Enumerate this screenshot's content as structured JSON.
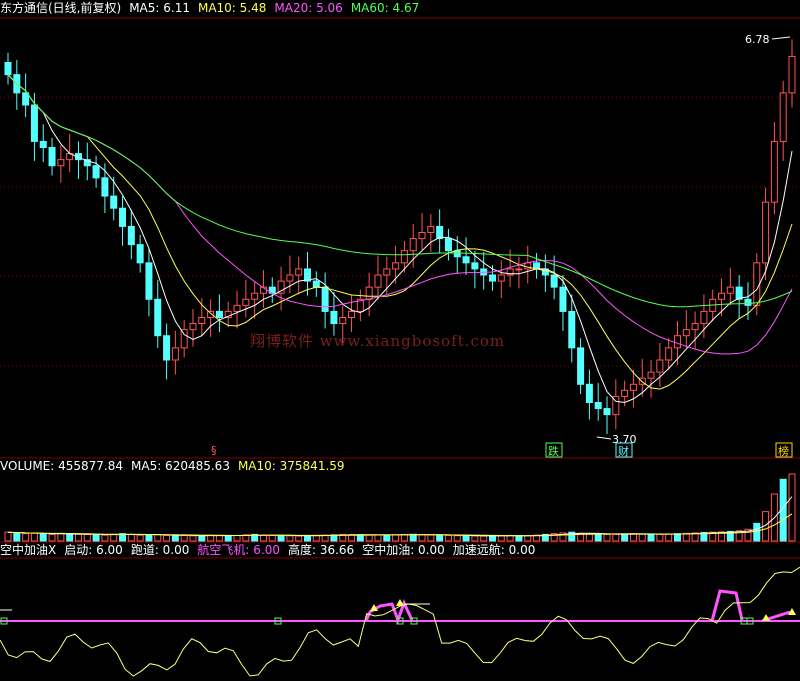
{
  "header_main": {
    "title": "东方通信(日线,前复权)",
    "ma5": "MA5: 6.11",
    "ma10": "MA10: 5.48",
    "ma20": "MA20: 5.06",
    "ma60": "MA60: 4.67"
  },
  "header_volume": {
    "volume": "VOLUME: 455877.84",
    "ma5": "MA5: 620485.63",
    "ma10": "MA10: 375841.59"
  },
  "header_indicator": {
    "name": "空中加油X",
    "qidong": "启动: 6.00",
    "paodao": "跑道: 0.00",
    "hangkong": "航空飞机: 6.00",
    "gaodu": "高度: 36.66",
    "kongzhong": "空中加油: 0.00",
    "jiasu": "加速远航: 0.00"
  },
  "annotations": {
    "high_label": "6.78",
    "low_label": "3.70",
    "marker_s": "§",
    "marker_die": "跌",
    "marker_cai": "财",
    "marker_bang": "榜"
  },
  "watermark": "翔博软件 www.xiangbosoft.com",
  "colors": {
    "up": "#ff5454",
    "down": "#54ffff",
    "ma5": "#ffffff",
    "ma10": "#ffff54",
    "ma20": "#ff54ff",
    "ma60": "#54ff54",
    "grid": "#800000"
  },
  "chart_data": [
    {
      "type": "candlestick",
      "title": "东方通信(日线,前复权)",
      "ylim": [
        3.5,
        7.0
      ],
      "low_value": 3.7,
      "high_value": 6.78,
      "series": [
        {
          "name": "MA5",
          "value": 6.11
        },
        {
          "name": "MA10",
          "value": 5.48
        },
        {
          "name": "MA20",
          "value": 5.06
        },
        {
          "name": "MA60",
          "value": 4.67
        }
      ],
      "closes": [
        6.55,
        6.4,
        6.3,
        6.0,
        5.95,
        5.8,
        5.85,
        5.9,
        5.85,
        5.8,
        5.7,
        5.55,
        5.45,
        5.3,
        5.15,
        5.0,
        4.7,
        4.4,
        4.2,
        4.3,
        4.45,
        4.5,
        4.55,
        4.6,
        4.55,
        4.6,
        4.65,
        4.7,
        4.75,
        4.8,
        4.75,
        4.85,
        4.9,
        4.95,
        4.85,
        4.8,
        4.6,
        4.5,
        4.55,
        4.6,
        4.7,
        4.8,
        4.9,
        4.95,
        5.0,
        5.1,
        5.2,
        5.25,
        5.3,
        5.2,
        5.1,
        5.05,
        5.0,
        4.95,
        4.9,
        4.85,
        4.9,
        4.95,
        4.95,
        5.0,
        4.95,
        4.9,
        4.8,
        4.6,
        4.3,
        4.0,
        3.85,
        3.8,
        3.75,
        3.9,
        3.95,
        4.0,
        4.05,
        4.1,
        4.2,
        4.3,
        4.4,
        4.45,
        4.5,
        4.6,
        4.7,
        4.75,
        4.8,
        4.7,
        4.65,
        5.0,
        5.5,
        6.0,
        6.4,
        6.7
      ]
    },
    {
      "type": "bar",
      "title": "VOLUME",
      "series": [
        {
          "name": "VOLUME",
          "value": 455877.84
        },
        {
          "name": "MA5",
          "value": 620485.63
        },
        {
          "name": "MA10",
          "value": 375841.59
        }
      ],
      "values": [
        60,
        55,
        50,
        52,
        48,
        45,
        50,
        47,
        46,
        44,
        42,
        40,
        45,
        50,
        44,
        40,
        42,
        43,
        38,
        36,
        37,
        35,
        36,
        40,
        38,
        35,
        37,
        42,
        45,
        40,
        38,
        36,
        35,
        34,
        36,
        38,
        40,
        42,
        45,
        44,
        43,
        42,
        41,
        40,
        42,
        44,
        46,
        43,
        41,
        40,
        38,
        36,
        35,
        34,
        33,
        35,
        36,
        38,
        37,
        36,
        40,
        45,
        50,
        55,
        60,
        52,
        48,
        45,
        44,
        46,
        48,
        50,
        47,
        45,
        46,
        48,
        50,
        52,
        55,
        58,
        60,
        62,
        65,
        70,
        80,
        120,
        200,
        320,
        420,
        456
      ]
    },
    {
      "type": "line",
      "title": "空中加油X",
      "series": [
        {
          "name": "启动",
          "value": 6.0
        },
        {
          "name": "跑道",
          "value": 0.0
        },
        {
          "name": "航空飞机",
          "value": 6.0
        },
        {
          "name": "高度",
          "value": 36.66
        },
        {
          "name": "空中加油",
          "value": 0.0
        },
        {
          "name": "加速远航",
          "value": 0.0
        }
      ]
    }
  ]
}
